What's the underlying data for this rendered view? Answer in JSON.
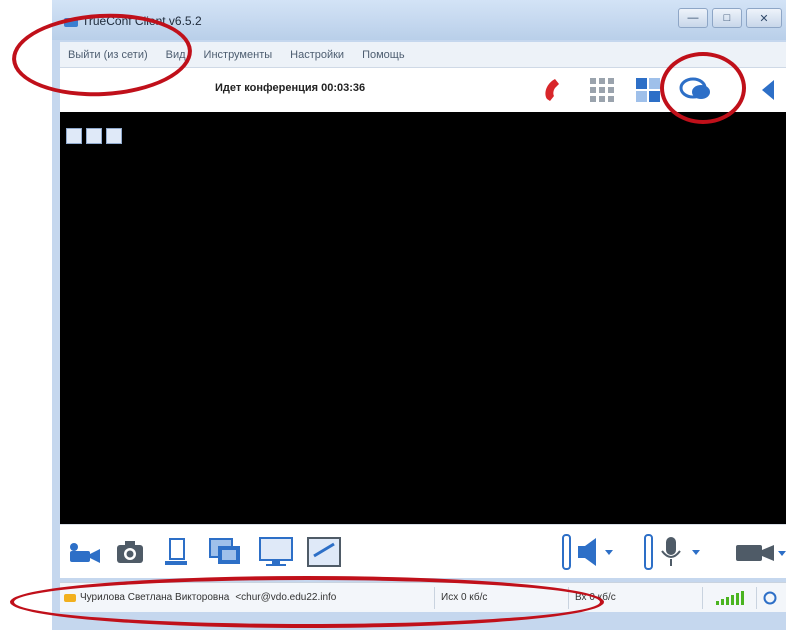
{
  "window": {
    "title": "TrueConf Client v6.5.2",
    "minimize_label": "—",
    "maximize_label": "□",
    "close_label": "✕"
  },
  "menu": {
    "items": [
      "Выйти (из сети)",
      "Вид",
      "Инструменты",
      "Настройки",
      "Помощь"
    ]
  },
  "toolbar": {
    "conference_status": "Идет конференция 00:03:36"
  },
  "status_bar": {
    "user_name": "Чурилова Светлана Викторовна",
    "user_email": "<chur@vdo.edu22.info",
    "outgoing": "Исх 0 кб/с",
    "incoming": "Вх 0 кб/с"
  },
  "colors": {
    "accent_blue": "#2d6fc7",
    "hangup_red": "#d8262a",
    "annotation_red": "#c0101a",
    "signal_green": "#4ab420"
  },
  "icons": {
    "toolbar": [
      "hangup-phone-icon",
      "grid-layout-icon",
      "participants-layout-icon",
      "chat-icon",
      "collapse-arrow-icon"
    ],
    "bottom": [
      "camera-icon",
      "snapshot-icon",
      "file-transfer-icon",
      "slideshow-icon",
      "screen-share-icon",
      "whiteboard-icon",
      "speaker-volume-icon",
      "microphone-icon",
      "video-camera-icon"
    ]
  }
}
